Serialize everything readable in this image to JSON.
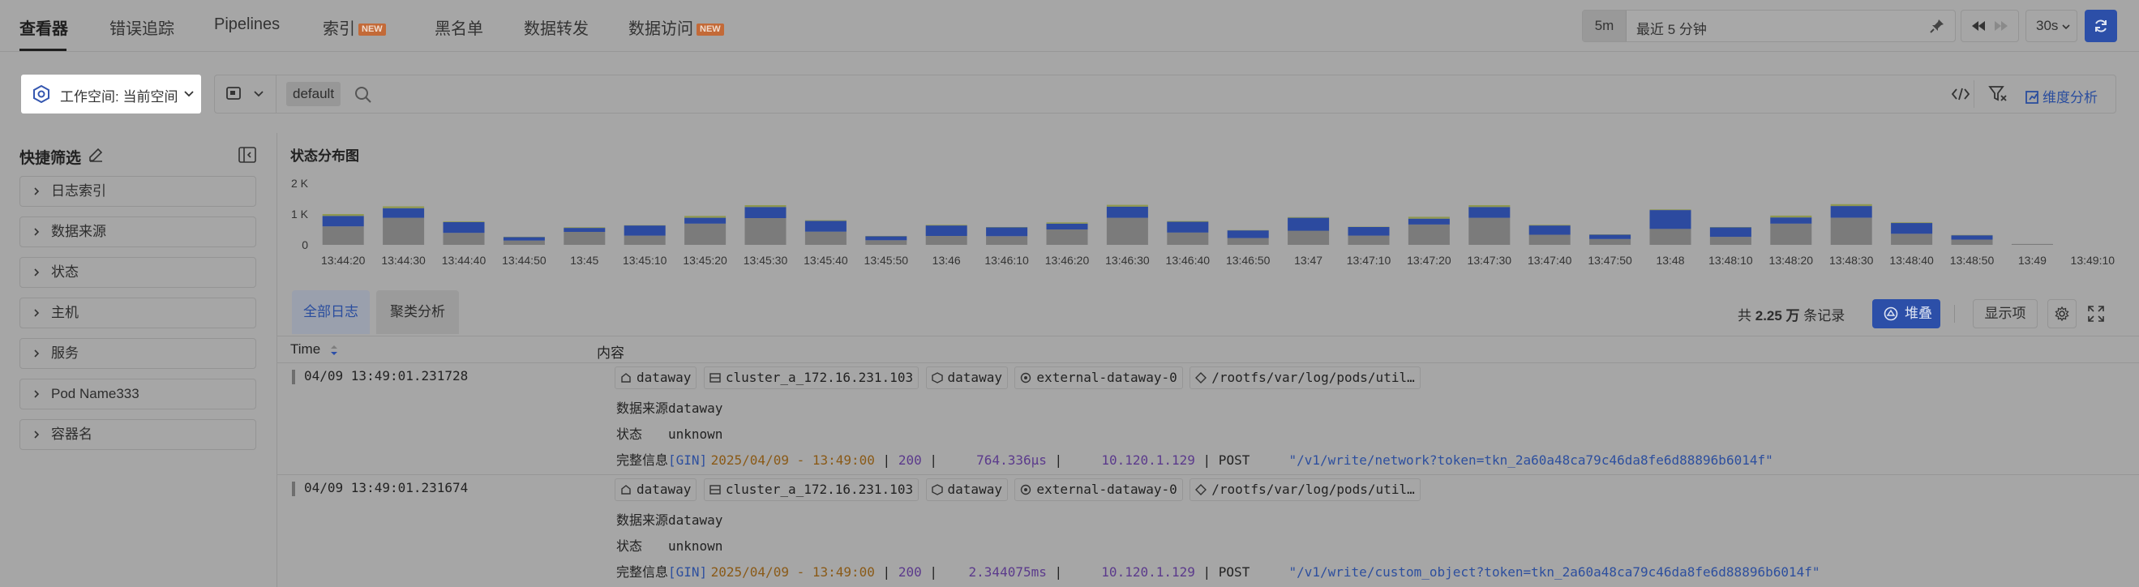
{
  "nav": {
    "tabs": [
      {
        "label": "查看器",
        "badge": ""
      },
      {
        "label": "错误追踪",
        "badge": ""
      },
      {
        "label": "Pipelines",
        "badge": ""
      },
      {
        "label": "索引",
        "badge": "NEW"
      },
      {
        "label": "黑名单",
        "badge": ""
      },
      {
        "label": "数据转发",
        "badge": ""
      },
      {
        "label": "数据访问",
        "badge": "NEW"
      }
    ],
    "time_short": "5m",
    "time_range": "最近 5 分钟",
    "refresh_interval": "30s"
  },
  "query": {
    "workspace_label": "工作空间: 当前空间",
    "index_chip": "default",
    "dimension_analysis": "维度分析"
  },
  "sidebar": {
    "title": "快捷筛选",
    "items": [
      "日志索引",
      "数据来源",
      "状态",
      "主机",
      "服务",
      "Pod Name333",
      "容器名"
    ]
  },
  "chart_title": "状态分布图",
  "chart_data": {
    "type": "bar",
    "stacked": true,
    "ylim": [
      0,
      2000
    ],
    "yticks": [
      "0",
      "1 K",
      "2 K"
    ],
    "x": [
      "13:44:20",
      "13:44:30",
      "13:44:40",
      "13:44:50",
      "13:45",
      "13:45:10",
      "13:45:20",
      "13:45:30",
      "13:45:40",
      "13:45:50",
      "13:46",
      "13:46:10",
      "13:46:20",
      "13:46:30",
      "13:46:40",
      "13:46:50",
      "13:47",
      "13:47:10",
      "13:47:20",
      "13:47:30",
      "13:47:40",
      "13:47:50",
      "13:48",
      "13:48:10",
      "13:48:20",
      "13:48:30",
      "13:48:40",
      "13:48:50",
      "13:49",
      "13:49:10"
    ],
    "series": [
      {
        "color": "#7b7b7b",
        "values": [
          600,
          880,
          390,
          140,
          420,
          300,
          690,
          870,
          430,
          150,
          290,
          280,
          500,
          880,
          400,
          220,
          460,
          300,
          660,
          880,
          330,
          190,
          520,
          260,
          690,
          880,
          360,
          170,
          30,
          0
        ]
      },
      {
        "color": "#2c4a9f",
        "values": [
          340,
          310,
          350,
          110,
          130,
          330,
          190,
          360,
          350,
          130,
          340,
          290,
          190,
          360,
          350,
          250,
          420,
          280,
          190,
          350,
          300,
          140,
          610,
          310,
          200,
          380,
          350,
          140,
          0,
          0
        ]
      },
      {
        "color": "#8f9850",
        "values": [
          60,
          60,
          20,
          10,
          20,
          10,
          60,
          60,
          20,
          10,
          20,
          10,
          40,
          60,
          20,
          10,
          20,
          10,
          60,
          60,
          20,
          10,
          20,
          10,
          60,
          60,
          20,
          10,
          0,
          0
        ]
      }
    ]
  },
  "list": {
    "tabs": [
      "全部日志",
      "聚类分析"
    ],
    "count_prefix": "共",
    "count_value": "2.25 万",
    "count_suffix": "条记录",
    "stack_button": "堆叠",
    "display_button": "显示项",
    "columns": [
      "Time",
      "内容"
    ]
  },
  "rows": [
    {
      "time": "04/09 13:49:01.231728",
      "tags": [
        "dataway",
        "cluster_a_172.16.231.103",
        "dataway",
        "external-dataway-0",
        "/rootfs/var/log/pods/util…"
      ],
      "source_label": "数据来源",
      "source": "dataway",
      "status_label": "状态",
      "status": "unknown",
      "msg_label": "完整信息",
      "msg": {
        "gin": "[GIN]",
        "ts": "2025/04/09 - 13:49:00",
        "sep1": " | ",
        "code": "200",
        "sep2": " |     ",
        "dur": "764.336µs",
        "sep3": " |     ",
        "ip": "10.120.1.129",
        "sep4": " | POST     ",
        "path": "\"/v1/write/network?token=tkn_2a60a48ca79c46da8fe6d88896b6014f\""
      }
    },
    {
      "time": "04/09 13:49:01.231674",
      "tags": [
        "dataway",
        "cluster_a_172.16.231.103",
        "dataway",
        "external-dataway-0",
        "/rootfs/var/log/pods/util…"
      ],
      "source_label": "数据来源",
      "source": "dataway",
      "status_label": "状态",
      "status": "unknown",
      "msg_label": "完整信息",
      "msg": {
        "gin": "[GIN]",
        "ts": "2025/04/09 - 13:49:00",
        "sep1": " | ",
        "code": "200",
        "sep2": " |    ",
        "dur": "2.344075ms",
        "sep3": " |     ",
        "ip": "10.120.1.129",
        "sep4": " | POST     ",
        "path": "\"/v1/write/custom_object?token=tkn_2a60a48ca79c46da8fe6d88896b6014f\""
      }
    }
  ]
}
